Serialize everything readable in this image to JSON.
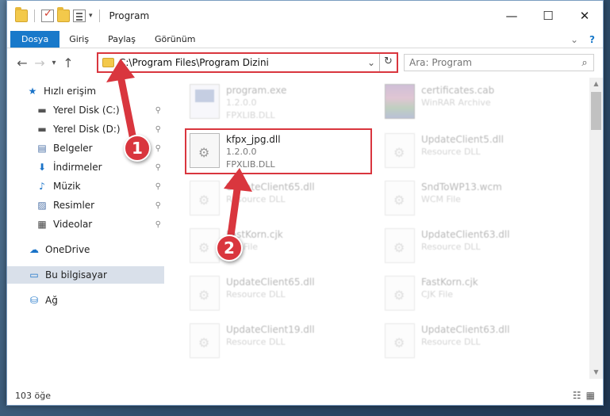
{
  "window": {
    "title": "Program",
    "controls": {
      "minimize": "—",
      "maximize": "☐",
      "close": "✕"
    }
  },
  "ribbon": {
    "tabs": [
      {
        "label": "Dosya"
      },
      {
        "label": "Giriş"
      },
      {
        "label": "Paylaş"
      },
      {
        "label": "Görünüm"
      }
    ],
    "expand_icon": "chevron-down-icon",
    "help_icon": "help-icon"
  },
  "navigation": {
    "back": "←",
    "forward": "→",
    "recent": "▾",
    "up": "↑",
    "address_path": "C:\\Program Files\\Program Dizini",
    "address_dropdown": "⌄",
    "refresh": "↻",
    "search_placeholder": "Ara: Program",
    "search_icon": "⌕"
  },
  "sidebar": {
    "items": [
      {
        "label": "Hızlı erişim",
        "icon": "★"
      },
      {
        "label": "Yerel Disk (C:)",
        "icon": "▬"
      },
      {
        "label": "Yerel Disk (D:)",
        "icon": "▬"
      },
      {
        "label": "Belgeler",
        "icon": "▤"
      },
      {
        "label": "İndirmeler",
        "icon": "⬇"
      },
      {
        "label": "Müzik",
        "icon": "♪"
      },
      {
        "label": "Resimler",
        "icon": "▨"
      },
      {
        "label": "Videolar",
        "icon": "▦"
      },
      {
        "label": "OneDrive",
        "icon": "☁"
      },
      {
        "label": "Bu bilgisayar",
        "icon": "▭"
      },
      {
        "label": "Ağ",
        "icon": "⛁"
      }
    ],
    "pin": "📌"
  },
  "files": [
    {
      "name": "program.exe",
      "line2": "1.2.0.0",
      "line3": "FPXLIB.DLL"
    },
    {
      "name": "certificates.cab",
      "line2": "WinRAR Archive",
      "line3": ""
    },
    {
      "name": "kfpx_jpg.dll",
      "line2": "1.2.0.0",
      "line3": "FPXLIB.DLL"
    },
    {
      "name": "UpdateClient5.dll",
      "line2": "Resource DLL",
      "line3": ""
    },
    {
      "name": "UpdateClient65.dll",
      "line2": "Resource DLL",
      "line3": ""
    },
    {
      "name": "SndToWP13.wcm",
      "line2": "WCM File",
      "line3": ""
    },
    {
      "name": "FastKorn.cjk",
      "line2": "CJK File",
      "line3": ""
    },
    {
      "name": "UpdateClient63.dll",
      "line2": "Resource DLL",
      "line3": ""
    },
    {
      "name": "UpdateClient65.dll",
      "line2": "Resource DLL",
      "line3": ""
    },
    {
      "name": "FastKorn.cjk",
      "line2": "CJK File",
      "line3": ""
    },
    {
      "name": "UpdateClient19.dll",
      "line2": "Resource DLL",
      "line3": ""
    },
    {
      "name": "UpdateClient63.dll",
      "line2": "Resource DLL",
      "line3": ""
    }
  ],
  "status": {
    "item_count": "103 öğe",
    "details_view": "☷",
    "tiles_view": "▦"
  },
  "annotations": {
    "step1": "1",
    "step2": "2",
    "color": "#d9363e"
  }
}
